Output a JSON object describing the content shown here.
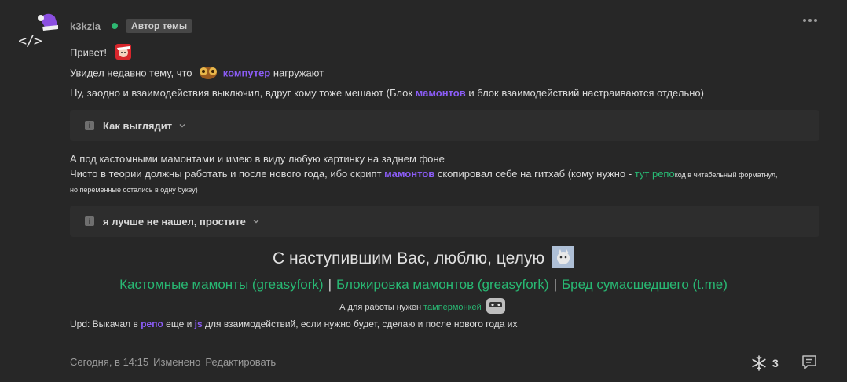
{
  "post": {
    "author": "k3kzia",
    "author_badge": "Автор темы",
    "line1": "Привет!",
    "line2_pre": "Увидел недавно тему, что",
    "line2_link": "компутер",
    "line2_post": "нагружают",
    "line3_pre": "Ну, заодно и взаимодействия выключил, вдруг кому тоже мешают (Блок",
    "line3_link": "мамонтов",
    "line3_post": "и блок взаимодействий настраиваются отдельно)",
    "spoiler1": "Как выглядит",
    "line4": "А под кастомными мамонтами и имею в виду любую картинку на заднем фоне",
    "line5_pre": "Чисто в теории должны работать и после нового года, ибо скрипт",
    "line5_link": "мамонтов",
    "line5_mid": "скопировал себе на гитхаб (кому нужно -",
    "line5_green": "тут репо",
    "line5_small": "код в читабельный форматнул,",
    "line6_small": "но переменные остались в одну букву)",
    "spoiler2": "я лучше не нашел, простите",
    "greeting": "С наступившим Вас, люблю, целую",
    "link_custom": "Кастомные мамонты (greasyfork)",
    "link_block": "Блокировка мамонтов (greasyfork)",
    "link_tme": "Бред сумасшедшего (t.me)",
    "separator": "|",
    "tamper_pre": "А для работы нужен",
    "tamper_link": "тампермонкей",
    "upd_pre": "Upd: Выкачал в",
    "upd_link1": "репо",
    "upd_mid": "еще и",
    "upd_link2": "js",
    "upd_post": "для взаимодействий, если нужно будет, сделаю и после нового года их"
  },
  "avatar_code": "</>",
  "footer": {
    "time": "Сегодня, в 14:15",
    "edited": "Изменено",
    "edit": "Редактировать"
  },
  "reactions": {
    "count": "3"
  },
  "icons": [
    "snowflake-icon",
    "comment-icon",
    "more-icon",
    "info-icon",
    "chevron-down-icon"
  ],
  "colors": {
    "mention": "#8b5cf6",
    "link": "#28b873",
    "online": "#2eb872",
    "background": "#272727"
  }
}
